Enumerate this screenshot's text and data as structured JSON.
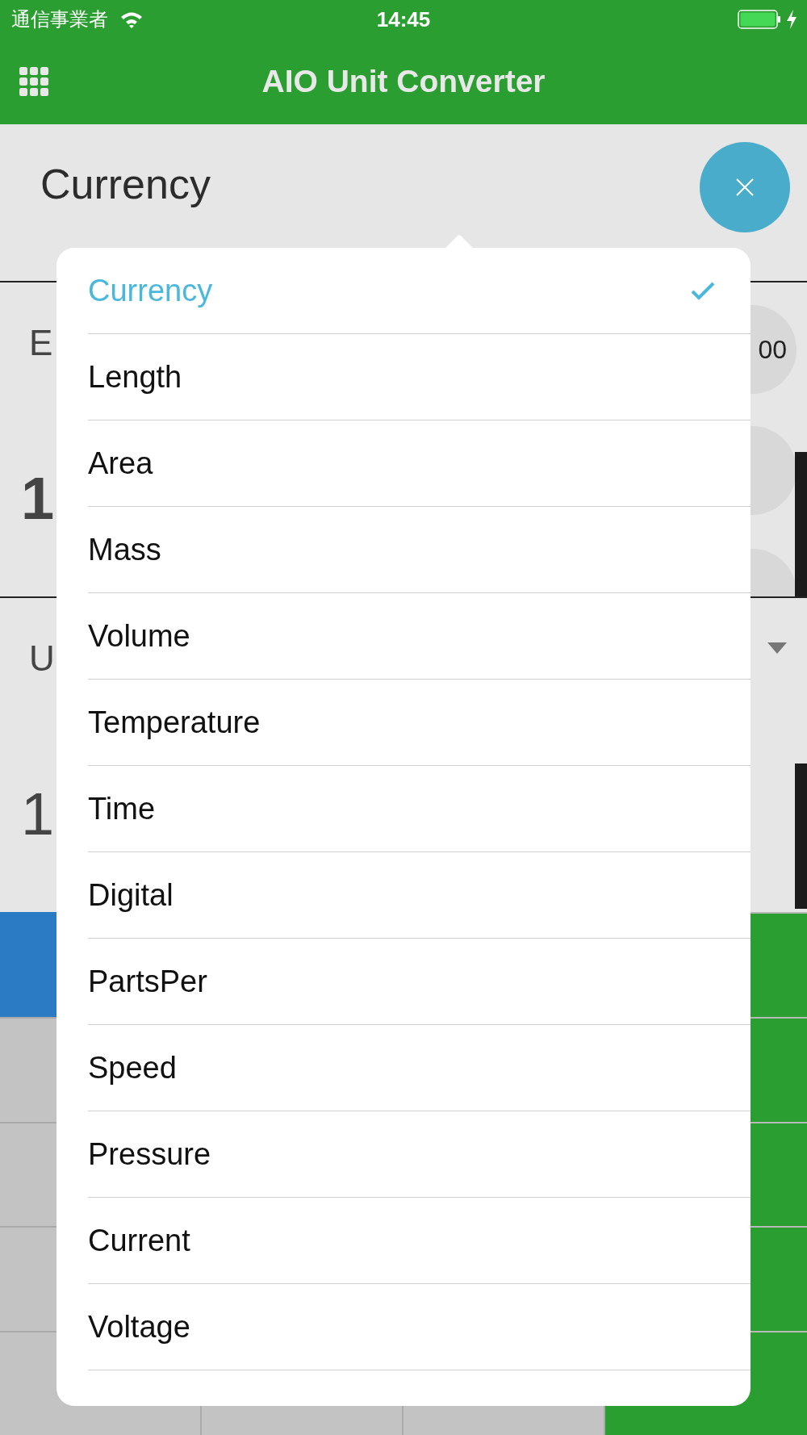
{
  "status_bar": {
    "carrier": "通信事業者",
    "time": "14:45"
  },
  "app_bar": {
    "title": "AIO Unit Converter"
  },
  "category": {
    "label": "Currency"
  },
  "converter_rows": [
    {
      "label": "E",
      "value": "1",
      "key": "00"
    },
    {
      "label": "U",
      "value": "1"
    }
  ],
  "popover": {
    "items": [
      {
        "label": "Currency",
        "selected": true
      },
      {
        "label": "Length",
        "selected": false
      },
      {
        "label": "Area",
        "selected": false
      },
      {
        "label": "Mass",
        "selected": false
      },
      {
        "label": "Volume",
        "selected": false
      },
      {
        "label": "Temperature",
        "selected": false
      },
      {
        "label": "Time",
        "selected": false
      },
      {
        "label": "Digital",
        "selected": false
      },
      {
        "label": "PartsPer",
        "selected": false
      },
      {
        "label": "Speed",
        "selected": false
      },
      {
        "label": "Pressure",
        "selected": false
      },
      {
        "label": "Current",
        "selected": false
      },
      {
        "label": "Voltage",
        "selected": false
      }
    ]
  }
}
